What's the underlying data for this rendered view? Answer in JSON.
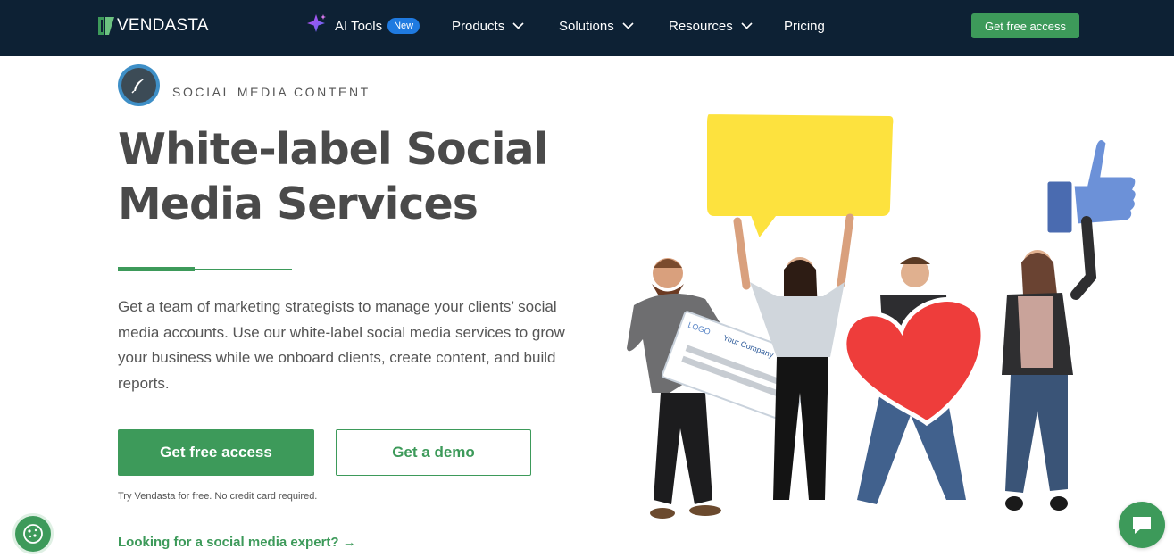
{
  "nav": {
    "logo_text": "VENDASTA",
    "ai_tools_label": "AI Tools",
    "ai_tools_badge": "New",
    "products_label": "Products",
    "solutions_label": "Solutions",
    "resources_label": "Resources",
    "pricing_label": "Pricing",
    "cta_label": "Get free access"
  },
  "hero": {
    "eyebrow": "SOCIAL MEDIA CONTENT",
    "title_line1": "White-label Social",
    "title_line2": "Media Services",
    "description": "Get a team of marketing strategists to manage your clients’ social media accounts. Use our white-label social media services to grow your business while we onboard clients, create content, and build reports.",
    "primary_cta": "Get free access",
    "secondary_cta": "Get a demo",
    "fineprint": "Try Vendasta for free. No credit card required.",
    "expert_link": "Looking for a social media expert? →"
  },
  "art": {
    "card_logo": "LOGO",
    "card_company": "Your Company"
  },
  "colors": {
    "nav_bg": "#0d2134",
    "brand_green": "#3d9a5a",
    "badge_blue": "#1f7ae0"
  }
}
